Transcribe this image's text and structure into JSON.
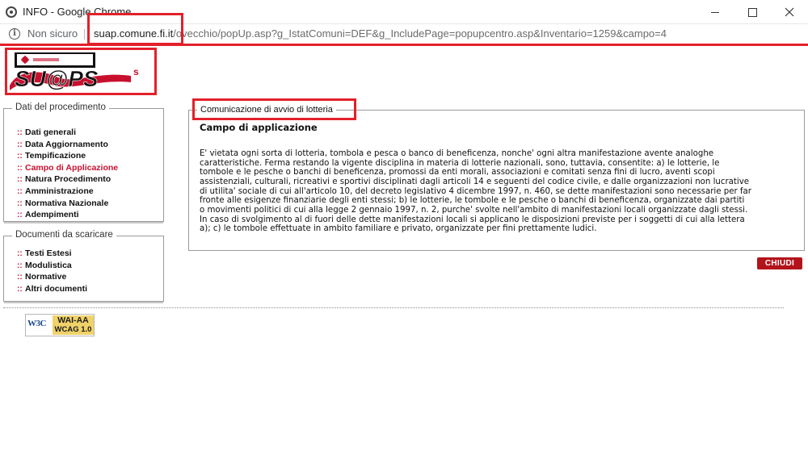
{
  "window": {
    "title": "INFO - Google Chrome",
    "minimize_icon": "minimize-icon",
    "maximize_icon": "maximize-icon",
    "close_icon": "close-icon"
  },
  "address_bar": {
    "security_label": "Non sicuro",
    "url_host": "suap.comune.fi.it",
    "url_path": "/ovecchio/popUp.asp?g_IstatComuni=DEF&g_IncludePage=popupcentro.asp&Inventario=1259&campo=4"
  },
  "logo": {
    "text": "SU@PS"
  },
  "sidebar": {
    "procedure": {
      "legend": "Dati del procedimento",
      "items": [
        {
          "label": "Dati generali",
          "active": false
        },
        {
          "label": "Data Aggiornamento",
          "active": false
        },
        {
          "label": "Tempificazione",
          "active": false
        },
        {
          "label": "Campo di Applicazione",
          "active": true
        },
        {
          "label": "Natura Procedimento",
          "active": false
        },
        {
          "label": "Amministrazione",
          "active": false
        },
        {
          "label": "Normativa Nazionale",
          "active": false
        },
        {
          "label": "Adempimenti",
          "active": false
        }
      ]
    },
    "documents": {
      "legend": "Documenti da scaricare",
      "items": [
        {
          "label": "Testi Estesi"
        },
        {
          "label": "Modulistica"
        },
        {
          "label": "Normative"
        },
        {
          "label": "Altri documenti"
        }
      ]
    },
    "bullet": "::"
  },
  "content": {
    "legend": "Comunicazione di avvio di lotteria",
    "heading": "Campo di applicazione",
    "lines": [
      "E' vietata ogni sorta di lotteria, tombola e pesca o banco di beneficenza, nonche' ogni altra manifestazione avente analoghe",
      "caratteristiche. Ferma restando la vigente disciplina in materia di lotterie nazionali, sono, tuttavia, consentite: a) le lotterie, le",
      "tombole e le pesche o banchi di beneficenza, promossi da enti morali, associazioni e comitati senza fini di lucro, aventi scopi",
      "assistenziali, culturali, ricreativi e sportivi disciplinati dagli articoli 14 e seguenti del codice civile, e dalle organizzazioni non lucrative",
      "di utilita' sociale di cui all'articolo 10, del decreto legislativo 4 dicembre 1997, n. 460, se dette manifestazioni sono necessarie per far",
      "fronte alle esigenze finanziarie degli enti stessi; b) le lotterie, le tombole e le pesche o banchi di beneficenza, organizzate dai partiti",
      "o movimenti politici di cui alla legge 2 gennaio 1997, n. 2, purche' svolte nell'ambito di manifestazioni locali organizzate dagli stessi.",
      "In caso di svolgimento al di fuori delle dette manifestazioni locali si applicano le disposizioni previste per i soggetti di cui alla lettera",
      "a); c) le tombole effettuate in ambito familiare e privato, organizzate per fini prettamente ludici."
    ]
  },
  "close_button": {
    "label": "CHIUDI"
  },
  "badge": {
    "logo": "W3C",
    "top": "WAI-AA",
    "bottom": "WCAG 1.0"
  },
  "colors": {
    "accent": "#c8102e",
    "highlight": "#e3202a",
    "button": "#b3141b"
  }
}
